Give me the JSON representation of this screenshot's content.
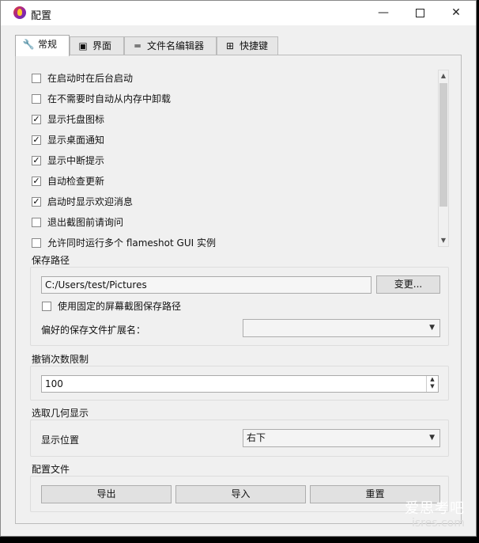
{
  "window": {
    "title": "配置"
  },
  "tabs": [
    {
      "label": "常规",
      "icon": "wrench-icon",
      "glyph": "🔧"
    },
    {
      "label": "界面",
      "icon": "layout-icon",
      "glyph": "▣"
    },
    {
      "label": "文件名编辑器",
      "icon": "text-lines-icon",
      "glyph": "═"
    },
    {
      "label": "快捷键",
      "icon": "grid-icon",
      "glyph": "⊞"
    }
  ],
  "general": {
    "options": [
      {
        "label": "在启动时在后台启动",
        "checked": false
      },
      {
        "label": "在不需要时自动从内存中卸载",
        "checked": false
      },
      {
        "label": "显示托盘图标",
        "checked": true
      },
      {
        "label": "显示桌面通知",
        "checked": true
      },
      {
        "label": "显示中断提示",
        "checked": true
      },
      {
        "label": "自动检查更新",
        "checked": true
      },
      {
        "label": "启动时显示欢迎消息",
        "checked": true
      },
      {
        "label": "退出截图前请询问",
        "checked": false
      },
      {
        "label": "允许同时运行多个 flameshot GUI 实例",
        "checked": false
      }
    ],
    "save_path": {
      "label": "保存路径",
      "value": "C:/Users/test/Pictures",
      "change_button": "变更...",
      "fixed_path_label": "使用固定的屏幕截图保存路径",
      "extension_label": "偏好的保存文件扩展名：",
      "extension_value": ""
    },
    "undo_limit": {
      "label": "撤销次数限制",
      "value": "100"
    },
    "selection_geometry": {
      "label": "选取几何显示",
      "position_label": "显示位置",
      "position_value": "右下"
    },
    "config_file": {
      "label": "配置文件",
      "export_button": "导出",
      "import_button": "导入",
      "reset_button": "重置"
    }
  },
  "watermark": {
    "line1": "爱思考吧",
    "line2": "isres.com"
  }
}
